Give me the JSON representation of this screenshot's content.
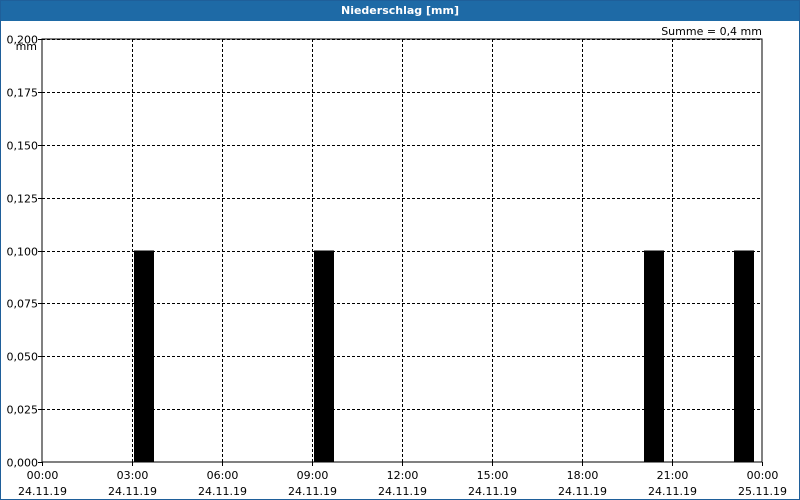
{
  "window": {
    "title": "Niederschlag [mm]"
  },
  "summary": {
    "text": "Summe = 0,4 mm"
  },
  "colors": {
    "titlebar": "#1e6aa6",
    "bar": "#000000",
    "grid": "#000000"
  },
  "chart_data": {
    "type": "bar",
    "title": "Niederschlag [mm]",
    "ylabel": "mm",
    "ylim": [
      0,
      0.2
    ],
    "yticks": [
      "0,000",
      "0,025",
      "0,050",
      "0,075",
      "0,100",
      "0,125",
      "0,150",
      "0,175",
      "0,200"
    ],
    "xlim_hours": [
      0,
      24
    ],
    "xticks": [
      {
        "time": "00:00",
        "date": "24.11.19"
      },
      {
        "time": "03:00",
        "date": "24.11.19"
      },
      {
        "time": "06:00",
        "date": "24.11.19"
      },
      {
        "time": "09:00",
        "date": "24.11.19"
      },
      {
        "time": "12:00",
        "date": "24.11.19"
      },
      {
        "time": "15:00",
        "date": "24.11.19"
      },
      {
        "time": "18:00",
        "date": "24.11.19"
      },
      {
        "time": "21:00",
        "date": "24.11.19"
      },
      {
        "time": "00:00",
        "date": "25.11.19"
      }
    ],
    "grid": true,
    "bars": [
      {
        "time": "24.11.19 03:00",
        "value": 0.1
      },
      {
        "time": "24.11.19 09:00",
        "value": 0.1
      },
      {
        "time": "24.11.19 20:00",
        "value": 0.1
      },
      {
        "time": "24.11.19 23:00",
        "value": 0.1
      }
    ]
  }
}
